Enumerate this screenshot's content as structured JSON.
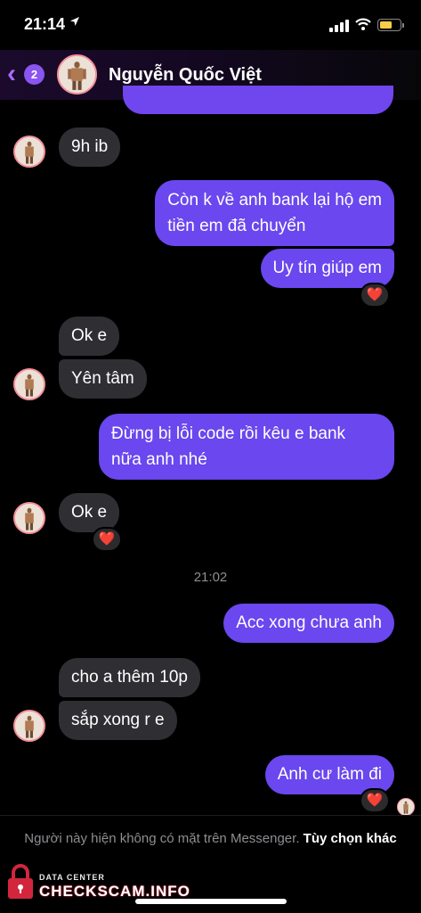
{
  "status_bar": {
    "time": "21:14",
    "location_icon": "location-arrow-icon"
  },
  "header": {
    "back_badge": "2",
    "contact_name": "Nguyễn Quốc Việt"
  },
  "messages": [
    {
      "side": "in",
      "text": "9h ib"
    },
    {
      "side": "out",
      "text_lines": [
        "Còn k về anh bank lại hộ em",
        "tiền em đã chuyển"
      ]
    },
    {
      "side": "out",
      "text": "Uy tín giúp em",
      "reaction": "❤️"
    },
    {
      "side": "in",
      "text": "Ok e"
    },
    {
      "side": "in",
      "text": "Yên tâm"
    },
    {
      "side": "out",
      "text_lines": [
        "Đừng bị lỗi code rồi kêu e bank",
        "nữa anh nhé"
      ]
    },
    {
      "side": "in",
      "text": "Ok e",
      "reaction": "❤️"
    },
    {
      "side": "out",
      "text": "Acc xong chưa anh"
    },
    {
      "side": "in",
      "text": "cho a thêm 10p"
    },
    {
      "side": "in",
      "text": "sắp xong r e"
    },
    {
      "side": "out",
      "text": "Anh cư làm đi",
      "reaction": "❤️"
    }
  ],
  "timestamp": "21:02",
  "notice": {
    "text": "Người này hiện không có mặt trên Messenger.",
    "link": "Tùy chọn khác"
  },
  "watermark": {
    "small": "DATA CENTER",
    "big": "CHECKSCAM.INFO"
  },
  "colors": {
    "outgoing_bubble": "#6a47ee",
    "incoming_bubble": "#2f2f33",
    "accent": "#8a55f0",
    "heart": "#ee2a3e"
  }
}
